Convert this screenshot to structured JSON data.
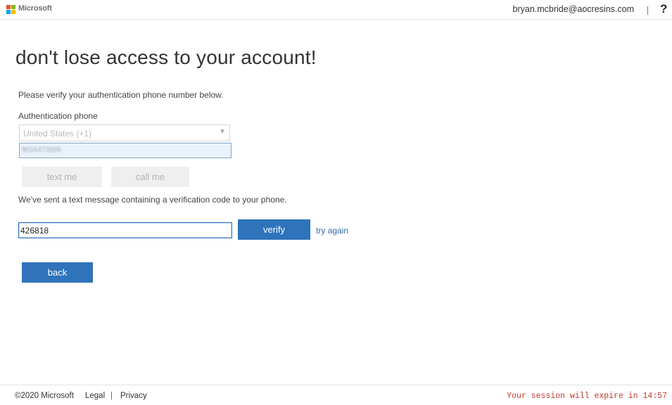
{
  "header": {
    "brand": "Microsoft",
    "user_email": "bryan.mcbride@aocresins.com",
    "divider": "|",
    "help_label": "?"
  },
  "main": {
    "title": "don't lose access to your account!",
    "instruction": "Please verify your authentication phone number below.",
    "phone_label": "Authentication phone",
    "country": {
      "value": "United States (+1)",
      "caret": "▼"
    },
    "phone_number": {
      "value": "9016472009",
      "blurred": true
    },
    "text_me_label": "text me",
    "call_me_label": "call me",
    "sent_message": "We've sent a text message containing a verification code to your phone.",
    "code_input": {
      "value": "426818"
    },
    "verify_label": "verify",
    "try_again_label": "try again",
    "back_label": "back"
  },
  "footer": {
    "copyright": "©2020 Microsoft",
    "legal": "Legal",
    "separator": "|",
    "privacy": "Privacy",
    "session": "Your session will expire in 14:57"
  },
  "colors": {
    "primary_button": "#2f73bb",
    "link": "#2f6aa6",
    "session_warning": "#c0392b",
    "disabled_button": "#efefef"
  }
}
